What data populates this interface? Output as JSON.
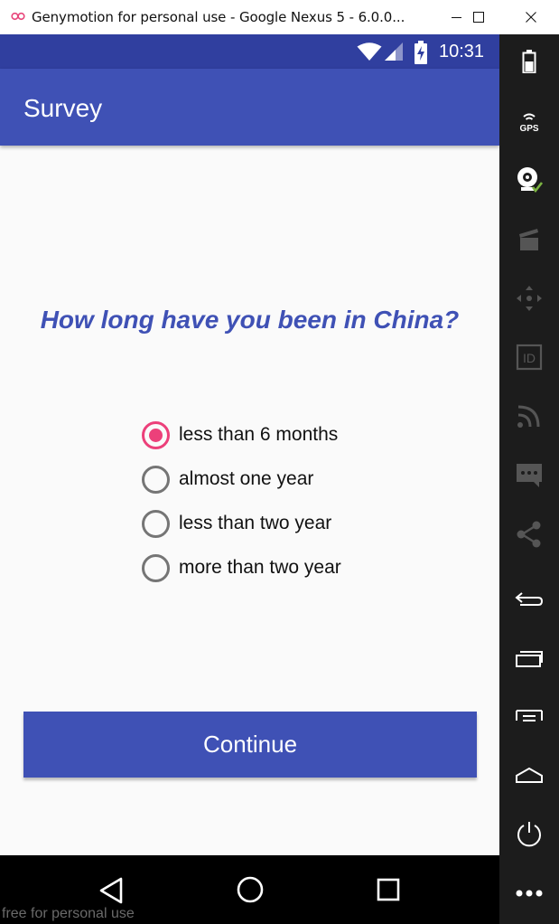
{
  "window": {
    "title": "Genymotion for personal use - Google Nexus 5 - 6.0.0...",
    "logo_icon": "genymotion-logo-icon",
    "controls": [
      "minimize-icon",
      "maximize-icon",
      "close-icon"
    ]
  },
  "statusbar": {
    "time": "10:31",
    "icons": [
      "wifi-icon",
      "signal-icon",
      "battery-charging-icon"
    ]
  },
  "appbar": {
    "title": "Survey"
  },
  "survey": {
    "question": "How long have you been in China?",
    "options": [
      {
        "label": "less than 6 months",
        "checked": true
      },
      {
        "label": "almost one year",
        "checked": false
      },
      {
        "label": "less than two year",
        "checked": false
      },
      {
        "label": "more than two year",
        "checked": false
      }
    ],
    "continue_label": "Continue"
  },
  "navbar": {
    "buttons": [
      "back-icon",
      "home-icon",
      "recents-icon"
    ]
  },
  "watermark": "free for personal use",
  "sidepanel": {
    "gps_label": "GPS",
    "id_label": "ID",
    "icons": [
      "battery-icon",
      "gps-icon",
      "webcam-icon",
      "capture-icon",
      "dpad-icon",
      "device-id-icon",
      "cast-icon",
      "sms-icon",
      "share-icon",
      "back-icon",
      "recent-apps-icon",
      "menu-icon",
      "home-icon",
      "power-icon",
      "more-icon"
    ]
  },
  "colors": {
    "primary": "#3f51b5",
    "primary_dark": "#303f9f",
    "accent": "#ec407a",
    "background": "#fafafa"
  }
}
